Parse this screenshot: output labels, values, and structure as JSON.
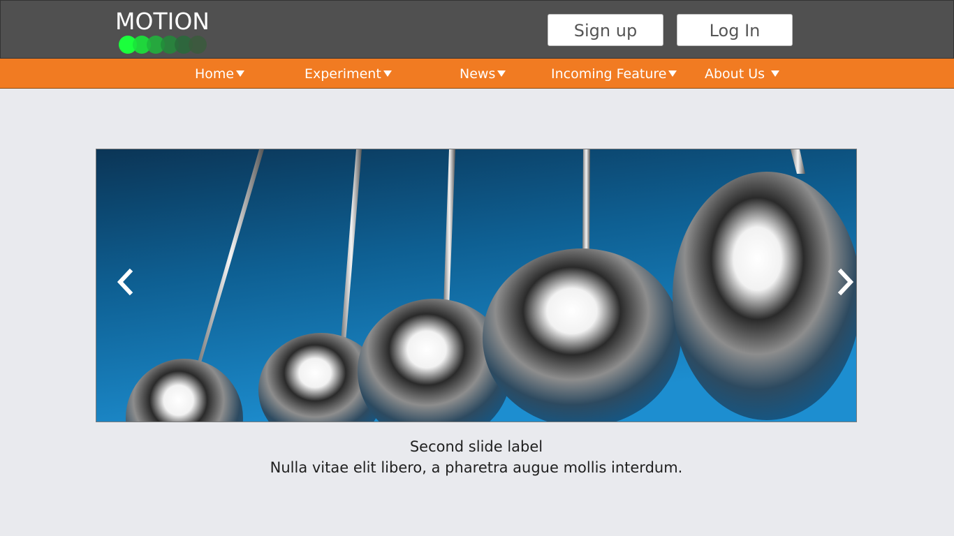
{
  "header": {
    "logo_text": "MOTION",
    "signup_label": "Sign up",
    "login_label": "Log In"
  },
  "nav": {
    "items": [
      {
        "label": "Home"
      },
      {
        "label": "Experiment"
      },
      {
        "label": "News"
      },
      {
        "label": "Incoming Feature"
      },
      {
        "label": "About Us"
      }
    ]
  },
  "carousel": {
    "prev_icon": "chevron-left-icon",
    "next_icon": "chevron-right-icon",
    "slide_title": "Second slide label",
    "slide_text": "Nulla vitae elit libero, a pharetra augue mollis interdum."
  },
  "colors": {
    "header_bg": "#505050",
    "nav_bg": "#f17b22",
    "page_bg": "#e9eaee",
    "logo_dots": [
      "#1bff3c",
      "#19e43a",
      "#1fb63b",
      "#228a3a",
      "#286a3a",
      "#3a5a3c"
    ]
  }
}
